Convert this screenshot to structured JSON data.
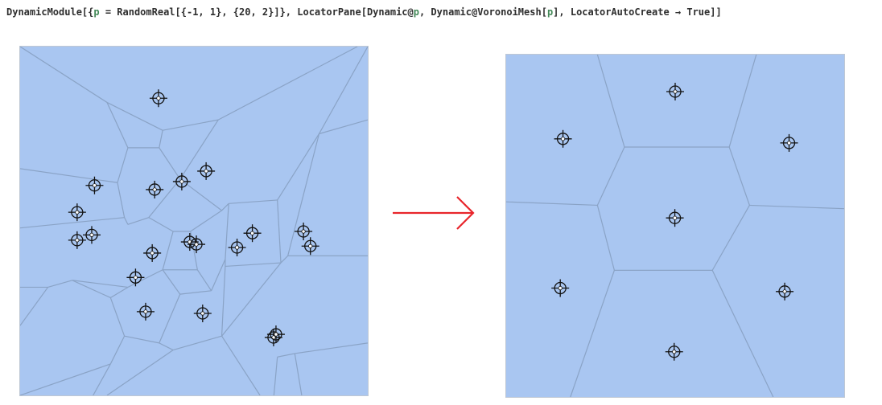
{
  "input_code": {
    "head": "DynamicModule[{",
    "var1": "p",
    "mid1": " = RandomReal[{-1, 1}, {20, 2}]}, LocatorPane[Dynamic@",
    "var2": "p",
    "mid2": ", Dynamic@VoronoiMesh[",
    "var3": "p",
    "tail": "], LocatorAutoCreate → True]]"
  },
  "colors": {
    "cell_fill": "#a9c6f1",
    "cell_edge": "#8aa3c6",
    "arrow": "#e8252b",
    "locator": "#111111"
  },
  "icons": {
    "locator": "crosshair-locator-icon",
    "arrow": "right-arrow-icon"
  },
  "left_diagram": {
    "locator_count": 20,
    "locators": [
      [
        0.398,
        0.852
      ],
      [
        0.214,
        0.602
      ],
      [
        0.387,
        0.59
      ],
      [
        0.465,
        0.613
      ],
      [
        0.535,
        0.643
      ],
      [
        0.164,
        0.525
      ],
      [
        0.164,
        0.445
      ],
      [
        0.206,
        0.46
      ],
      [
        0.38,
        0.408
      ],
      [
        0.488,
        0.44
      ],
      [
        0.507,
        0.433
      ],
      [
        0.332,
        0.338
      ],
      [
        0.624,
        0.424
      ],
      [
        0.668,
        0.465
      ],
      [
        0.815,
        0.47
      ],
      [
        0.835,
        0.428
      ],
      [
        0.361,
        0.24
      ],
      [
        0.525,
        0.235
      ],
      [
        0.729,
        0.166
      ],
      [
        0.736,
        0.175
      ]
    ],
    "edges": [
      [
        [
          0.0,
          1.0
        ],
        [
          0.25,
          0.84
        ]
      ],
      [
        [
          0.25,
          0.84
        ],
        [
          0.31,
          0.71
        ]
      ],
      [
        [
          0.25,
          0.84
        ],
        [
          0.41,
          0.76
        ]
      ],
      [
        [
          0.41,
          0.76
        ],
        [
          0.57,
          0.79
        ]
      ],
      [
        [
          0.57,
          0.79
        ],
        [
          0.97,
          1.0
        ]
      ],
      [
        [
          0.31,
          0.71
        ],
        [
          0.4,
          0.71
        ]
      ],
      [
        [
          0.4,
          0.71
        ],
        [
          0.41,
          0.76
        ]
      ],
      [
        [
          0.31,
          0.71
        ],
        [
          0.28,
          0.61
        ]
      ],
      [
        [
          0.4,
          0.71
        ],
        [
          0.46,
          0.62
        ]
      ],
      [
        [
          0.46,
          0.62
        ],
        [
          0.57,
          0.79
        ]
      ],
      [
        [
          0.0,
          0.65
        ],
        [
          0.28,
          0.61
        ]
      ],
      [
        [
          0.28,
          0.61
        ],
        [
          0.3,
          0.51
        ]
      ],
      [
        [
          0.0,
          0.48
        ],
        [
          0.3,
          0.51
        ]
      ],
      [
        [
          0.3,
          0.51
        ],
        [
          0.31,
          0.49
        ]
      ],
      [
        [
          0.31,
          0.49
        ],
        [
          0.37,
          0.51
        ]
      ],
      [
        [
          0.37,
          0.51
        ],
        [
          0.46,
          0.62
        ]
      ],
      [
        [
          0.46,
          0.62
        ],
        [
          0.58,
          0.53
        ]
      ],
      [
        [
          0.58,
          0.53
        ],
        [
          0.6,
          0.55
        ]
      ],
      [
        [
          0.6,
          0.55
        ],
        [
          0.74,
          0.56
        ]
      ],
      [
        [
          0.74,
          0.56
        ],
        [
          0.86,
          0.75
        ]
      ],
      [
        [
          0.86,
          0.75
        ],
        [
          1.0,
          1.0
        ]
      ],
      [
        [
          0.86,
          0.75
        ],
        [
          1.0,
          0.79
        ]
      ],
      [
        [
          0.0,
          0.31
        ],
        [
          0.08,
          0.31
        ]
      ],
      [
        [
          0.08,
          0.31
        ],
        [
          0.15,
          0.33
        ]
      ],
      [
        [
          0.15,
          0.33
        ],
        [
          0.26,
          0.28
        ]
      ],
      [
        [
          0.26,
          0.28
        ],
        [
          0.3,
          0.17
        ]
      ],
      [
        [
          0.3,
          0.17
        ],
        [
          0.4,
          0.15
        ]
      ],
      [
        [
          0.4,
          0.15
        ],
        [
          0.46,
          0.29
        ]
      ],
      [
        [
          0.46,
          0.29
        ],
        [
          0.41,
          0.36
        ]
      ],
      [
        [
          0.41,
          0.36
        ],
        [
          0.44,
          0.47
        ]
      ],
      [
        [
          0.44,
          0.47
        ],
        [
          0.37,
          0.51
        ]
      ],
      [
        [
          0.44,
          0.47
        ],
        [
          0.49,
          0.47
        ]
      ],
      [
        [
          0.49,
          0.47
        ],
        [
          0.58,
          0.53
        ]
      ],
      [
        [
          0.49,
          0.47
        ],
        [
          0.51,
          0.36
        ]
      ],
      [
        [
          0.51,
          0.36
        ],
        [
          0.41,
          0.36
        ]
      ],
      [
        [
          0.51,
          0.36
        ],
        [
          0.55,
          0.3
        ]
      ],
      [
        [
          0.55,
          0.3
        ],
        [
          0.46,
          0.29
        ]
      ],
      [
        [
          0.55,
          0.3
        ],
        [
          0.59,
          0.39
        ]
      ],
      [
        [
          0.59,
          0.39
        ],
        [
          0.59,
          0.37
        ]
      ],
      [
        [
          0.59,
          0.39
        ],
        [
          0.6,
          0.55
        ]
      ],
      [
        [
          0.59,
          0.37
        ],
        [
          0.75,
          0.38
        ]
      ],
      [
        [
          0.75,
          0.38
        ],
        [
          0.74,
          0.56
        ]
      ],
      [
        [
          0.75,
          0.38
        ],
        [
          0.77,
          0.4
        ]
      ],
      [
        [
          0.77,
          0.4
        ],
        [
          1.0,
          0.4
        ]
      ],
      [
        [
          0.77,
          0.4
        ],
        [
          0.86,
          0.75
        ]
      ],
      [
        [
          0.59,
          0.37
        ],
        [
          0.58,
          0.17
        ]
      ],
      [
        [
          0.58,
          0.17
        ],
        [
          0.69,
          0.0
        ]
      ],
      [
        [
          0.58,
          0.17
        ],
        [
          0.44,
          0.13
        ]
      ],
      [
        [
          0.44,
          0.13
        ],
        [
          0.4,
          0.15
        ]
      ],
      [
        [
          0.44,
          0.13
        ],
        [
          0.25,
          0.0
        ]
      ],
      [
        [
          0.3,
          0.17
        ],
        [
          0.26,
          0.09
        ]
      ],
      [
        [
          0.26,
          0.09
        ],
        [
          0.21,
          0.0
        ]
      ],
      [
        [
          0.26,
          0.09
        ],
        [
          0.0,
          0.0
        ]
      ],
      [
        [
          0.26,
          0.28
        ],
        [
          0.31,
          0.31
        ]
      ],
      [
        [
          0.31,
          0.31
        ],
        [
          0.41,
          0.36
        ]
      ],
      [
        [
          0.31,
          0.31
        ],
        [
          0.15,
          0.33
        ]
      ],
      [
        [
          0.08,
          0.31
        ],
        [
          0.0,
          0.2
        ]
      ],
      [
        [
          0.58,
          0.17
        ],
        [
          0.75,
          0.38
        ]
      ],
      [
        [
          0.74,
          0.11
        ],
        [
          0.79,
          0.12
        ]
      ],
      [
        [
          0.74,
          0.11
        ],
        [
          0.73,
          0.0
        ]
      ],
      [
        [
          0.79,
          0.12
        ],
        [
          1.0,
          0.15
        ]
      ],
      [
        [
          0.79,
          0.12
        ],
        [
          0.81,
          0.0
        ]
      ]
    ]
  },
  "right_diagram": {
    "locator_count": 7,
    "locators": [
      [
        0.497,
        0.132
      ],
      [
        0.16,
        0.318
      ],
      [
        0.824,
        0.308
      ],
      [
        0.499,
        0.523
      ],
      [
        0.168,
        0.754
      ],
      [
        0.837,
        0.742
      ],
      [
        0.5,
        0.892
      ]
    ],
    "edges": [
      [
        [
          0.0,
          0.57
        ],
        [
          0.27,
          0.56
        ]
      ],
      [
        [
          0.27,
          0.56
        ],
        [
          0.32,
          0.37
        ]
      ],
      [
        [
          0.27,
          0.56
        ],
        [
          0.35,
          0.73
        ]
      ],
      [
        [
          0.32,
          0.37
        ],
        [
          0.19,
          0.0
        ]
      ],
      [
        [
          0.32,
          0.37
        ],
        [
          0.61,
          0.37
        ]
      ],
      [
        [
          0.61,
          0.37
        ],
        [
          0.79,
          0.0
        ]
      ],
      [
        [
          0.61,
          0.37
        ],
        [
          0.72,
          0.56
        ]
      ],
      [
        [
          0.72,
          0.56
        ],
        [
          1.0,
          0.55
        ]
      ],
      [
        [
          0.72,
          0.56
        ],
        [
          0.66,
          0.73
        ]
      ],
      [
        [
          0.66,
          0.73
        ],
        [
          0.35,
          0.73
        ]
      ],
      [
        [
          0.35,
          0.73
        ],
        [
          0.27,
          1.0
        ]
      ],
      [
        [
          0.66,
          0.73
        ],
        [
          0.74,
          1.0
        ]
      ]
    ]
  }
}
